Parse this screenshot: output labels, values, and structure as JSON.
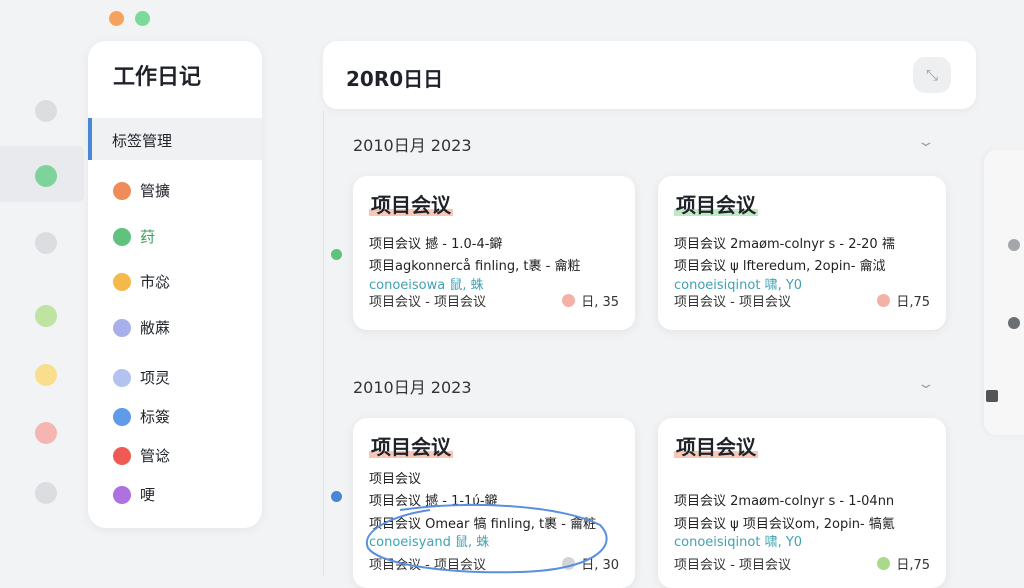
{
  "window": {
    "traffic_lights": [
      "#f5a25d",
      "#7cd99a"
    ]
  },
  "rail": {
    "dots": [
      "#dcdde0",
      "#7ed39b",
      "#dcdde0",
      "#bfe3a2",
      "#f9de8e",
      "#f4b6b3",
      "#dcdde0"
    ]
  },
  "sidebar": {
    "title": "工作日记",
    "active_item": "标签管理",
    "items": [
      {
        "label": "管擴",
        "color": "#f08c5a"
      },
      {
        "label": "荮",
        "color": "#5fc27d"
      },
      {
        "label": "市惢",
        "color": "#f5b84a"
      },
      {
        "label": "敝蔴",
        "color": "#a7b0ea"
      },
      {
        "label": "项灵",
        "color": "#b3c2ee"
      },
      {
        "label": "标簽",
        "color": "#5f9be8"
      },
      {
        "label": "管谂",
        "color": "#ef5a55"
      },
      {
        "label": "哽",
        "color": "#ad72e0"
      }
    ]
  },
  "header": {
    "title": "20R0日日",
    "button_icon": "collapse-icon"
  },
  "groups": [
    {
      "title": "2010日月 2023",
      "cards": [
        {
          "title": "项目会议",
          "underline": "#f7c8b7",
          "lines": [
            "项目会议 撼 - 1.0-4-鐴",
            "项目agkonnercå finling, t裹 - 龠粧"
          ],
          "teal_line": "conoeisowa 鼠, 蛛",
          "footer_left": "项目会议 - 项目会议",
          "footer_right": "日, 35",
          "dot": "#f4b2a6"
        },
        {
          "title": "项目会议",
          "underline": "#bfe8c4",
          "lines": [
            "项目会议 2maøm-colnyr s - 2-20 襦",
            "项目会议 ψ lfteredum, 2opin- 龠泧"
          ],
          "teal_line": "conoeisiqinot 啸, Y0",
          "footer_left": "项目会议 - 项目会议",
          "footer_right": "日,75",
          "dot": "#f4b2a6"
        }
      ]
    },
    {
      "title": "2010日月 2023",
      "cards": [
        {
          "title": "项目会议",
          "underline": "#f7c8b7",
          "subtitle": "项目会议",
          "lines": [
            "项目会议 撼 - 1-1ύ-鐴",
            "项目会议 Omear 犒 finling, t裹 - 龠粧"
          ],
          "teal_line": "conoeisyand 鼠, 蛛",
          "footer_left": "项目会议 - 项目会议",
          "footer_right": "日, 30",
          "dot": "#d3d4d8"
        },
        {
          "title": "项目会议",
          "underline": "#f7c8b7",
          "lines": [
            "项目会议 2maøm-colnyr s - 1-04nn",
            "项目会议 ψ 项目会议om, 2opin- 犒氪"
          ],
          "teal_line": "conoeisiqinot 啸, Y0",
          "footer_left": "项目会议 - 项目会议",
          "footer_right": "日,75",
          "dot": "#a9d98a"
        }
      ]
    }
  ],
  "timeline_dots": [
    "#5fc27d",
    "#4a86d6"
  ],
  "right_panel": {
    "dots": [
      "#a3a6ab",
      "#6b6e73"
    ]
  }
}
